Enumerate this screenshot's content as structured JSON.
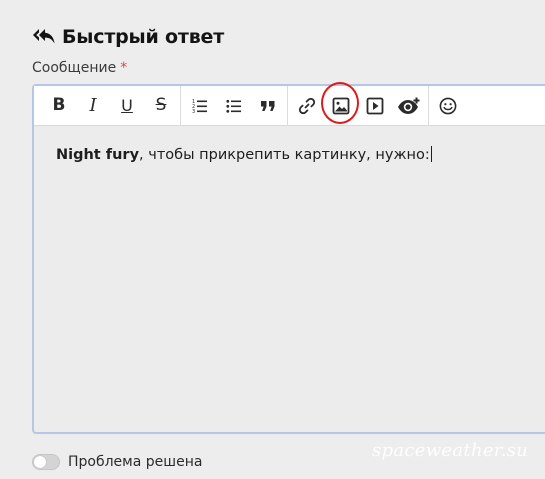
{
  "header": {
    "title": "Быстрый ответ",
    "icon": "reply-all-icon"
  },
  "message_field": {
    "label": "Сообщение",
    "required_marker": "*"
  },
  "toolbar": {
    "groups": [
      [
        {
          "name": "bold-button",
          "glyph": "B",
          "icon": "bold-icon"
        },
        {
          "name": "italic-button",
          "glyph": "I",
          "icon": "italic-icon"
        },
        {
          "name": "underline-button",
          "glyph": "U",
          "icon": "underline-icon"
        },
        {
          "name": "strikethrough-button",
          "glyph": "S",
          "icon": "strikethrough-icon"
        }
      ],
      [
        {
          "name": "ordered-list-button",
          "icon": "ordered-list-icon"
        },
        {
          "name": "unordered-list-button",
          "icon": "unordered-list-icon"
        },
        {
          "name": "quote-button",
          "icon": "quote-icon"
        }
      ],
      [
        {
          "name": "link-button",
          "icon": "link-icon"
        },
        {
          "name": "image-button",
          "icon": "image-icon",
          "highlighted": true
        },
        {
          "name": "media-button",
          "icon": "video-icon"
        },
        {
          "name": "preview-button",
          "icon": "eye-plus-icon"
        }
      ],
      [
        {
          "name": "emoji-button",
          "icon": "smiley-icon"
        }
      ]
    ],
    "highlight_color": "#e01a1a"
  },
  "editor": {
    "content_bold": "Night fury",
    "content_rest": ", чтобы прикрепить картинку, нужно:",
    "border_color": "#b8c6e6"
  },
  "problem_toggle": {
    "label": "Проблема решена",
    "checked": false
  },
  "watermark": {
    "text": "spaceweather.su"
  }
}
